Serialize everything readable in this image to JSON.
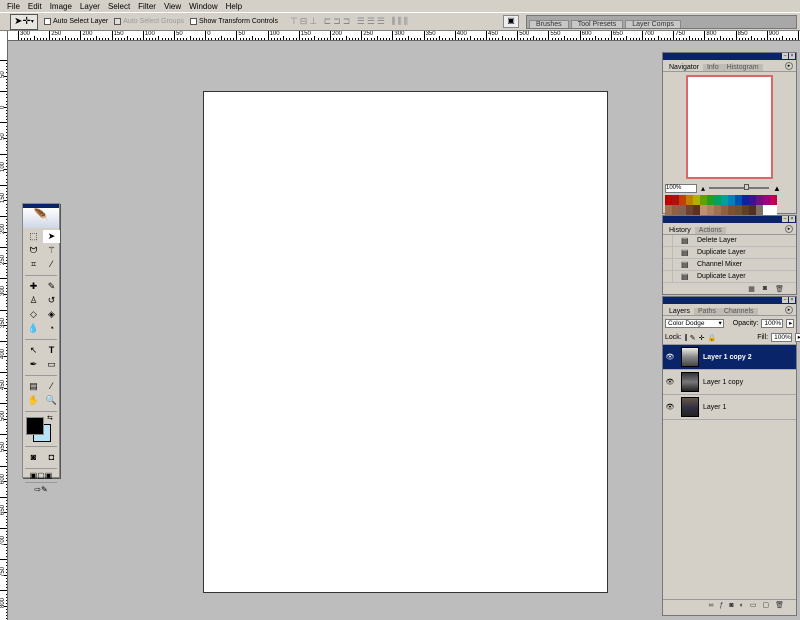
{
  "menu": [
    "File",
    "Edit",
    "Image",
    "Layer",
    "Select",
    "Filter",
    "View",
    "Window",
    "Help"
  ],
  "options": {
    "tool_icon": "move-tool",
    "auto_select_layer": "Auto Select Layer",
    "auto_select_groups": "Auto Select Groups",
    "show_transform_controls": "Show Transform Controls",
    "palette_well_tabs": [
      "Brushes",
      "Tool Presets",
      "Layer Comps"
    ]
  },
  "ruler_top_labels": [
    "300",
    "250",
    "200",
    "150",
    "100",
    "50",
    "0",
    "50",
    "100",
    "150",
    "200",
    "250",
    "300",
    "350",
    "400",
    "450",
    "500",
    "550",
    "600",
    "650",
    "700",
    "750",
    "800",
    "850",
    "900"
  ],
  "ruler_left_labels": [
    "50",
    "0",
    "50",
    "100",
    "150",
    "200",
    "250",
    "300",
    "350",
    "400",
    "450",
    "500",
    "550",
    "600",
    "650",
    "700",
    "750",
    "800"
  ],
  "navigator": {
    "tabs": [
      "Navigator",
      "Info",
      "Histogram"
    ],
    "zoom": "100%"
  },
  "swatch_colors": [
    "#c00000",
    "#b01010",
    "#c04000",
    "#c08000",
    "#b0b000",
    "#60a000",
    "#20a020",
    "#00a060",
    "#00a0a0",
    "#0080c0",
    "#0050b0",
    "#1020a0",
    "#401090",
    "#701080",
    "#a00080",
    "#c00050",
    "#a07050",
    "#906040",
    "#806050",
    "#704030",
    "#603020",
    "#c09070",
    "#b08060",
    "#a07050",
    "#906040",
    "#805030",
    "#705030",
    "#604020",
    "#503020",
    "#807060",
    "#fff",
    "#fff"
  ],
  "history": {
    "tabs": [
      "History",
      "Actions"
    ],
    "items": [
      "Delete Layer",
      "Duplicate Layer",
      "Channel Mixer",
      "Duplicate Layer"
    ]
  },
  "layers": {
    "tabs": [
      "Layers",
      "Paths",
      "Channels"
    ],
    "blend_mode": "Color Dodge",
    "opacity_label": "Opacity:",
    "opacity": "100%",
    "lock_label": "Lock:",
    "fill_label": "Fill:",
    "fill": "100%",
    "items": [
      {
        "name": "Layer 1 copy 2",
        "selected": true
      },
      {
        "name": "Layer 1 copy"
      },
      {
        "name": "Layer 1"
      }
    ]
  },
  "colors": {
    "foreground": "#000000",
    "background": "#b8e4f8"
  }
}
